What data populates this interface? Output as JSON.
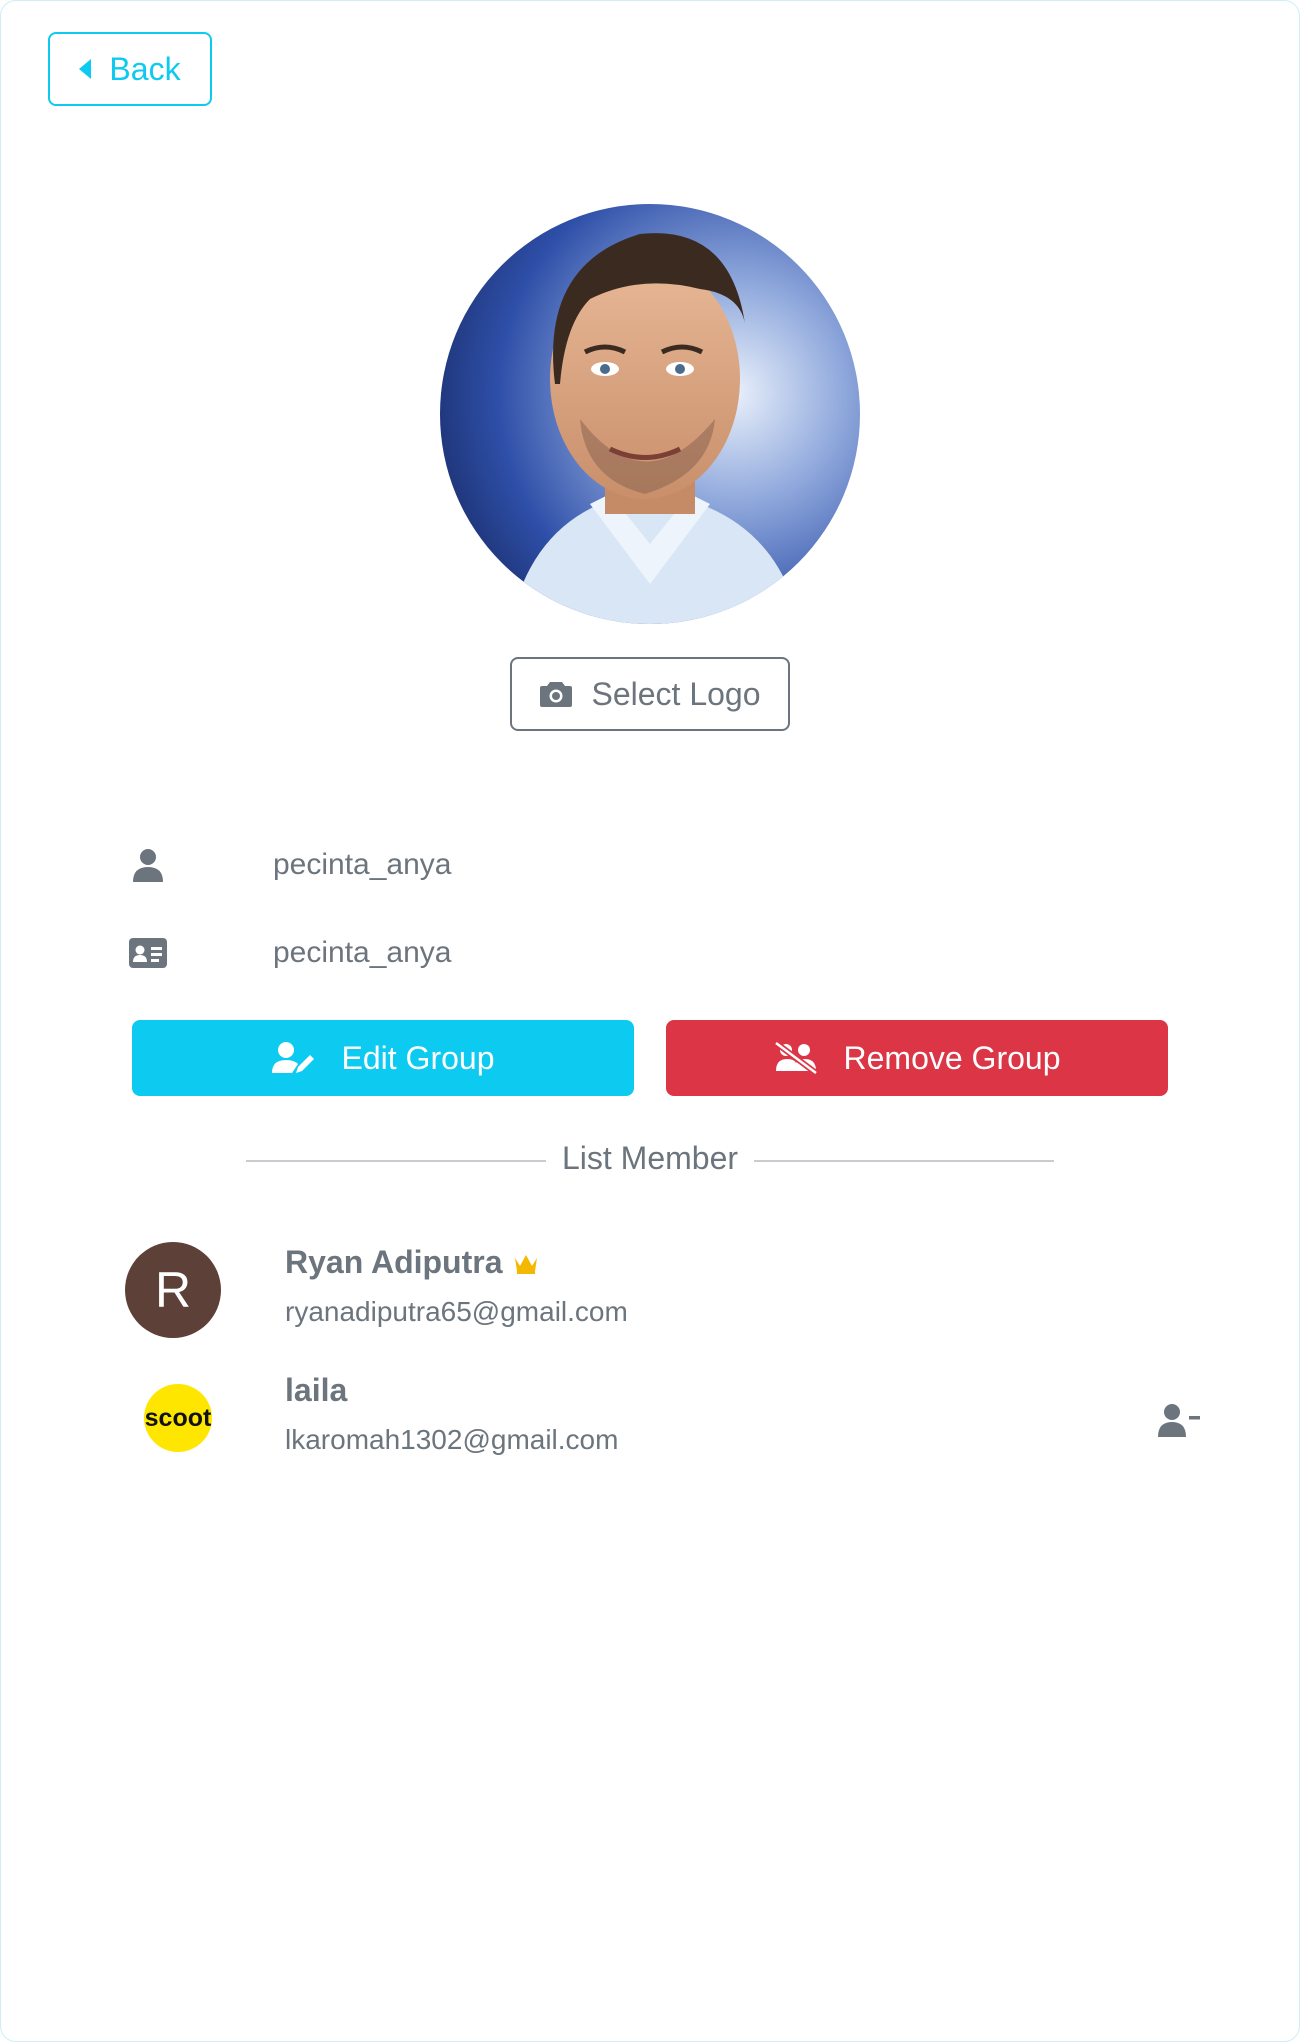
{
  "header": {
    "back_label": "Back"
  },
  "profile": {
    "logo_alt": "Group logo photo",
    "select_logo_label": "Select Logo",
    "username": "pecinta_anya",
    "group_id": "pecinta_anya"
  },
  "actions": {
    "edit_label": "Edit Group",
    "remove_label": "Remove Group"
  },
  "members_section": {
    "title": "List Member",
    "members": [
      {
        "initial": "R",
        "name": "Ryan Adiputra",
        "email": "ryanadiputra65@gmail.com",
        "is_owner": true
      },
      {
        "logo_text": "scoot",
        "name": "laila",
        "email": "lkaromah1302@gmail.com",
        "is_owner": false
      }
    ]
  },
  "colors": {
    "info": "#0dcaf0",
    "danger": "#dc3545",
    "secondary": "#6c757d",
    "owner_crown": "#f5b800",
    "avatar_r": "#5d4037",
    "scoot_yellow": "#ffe600"
  }
}
